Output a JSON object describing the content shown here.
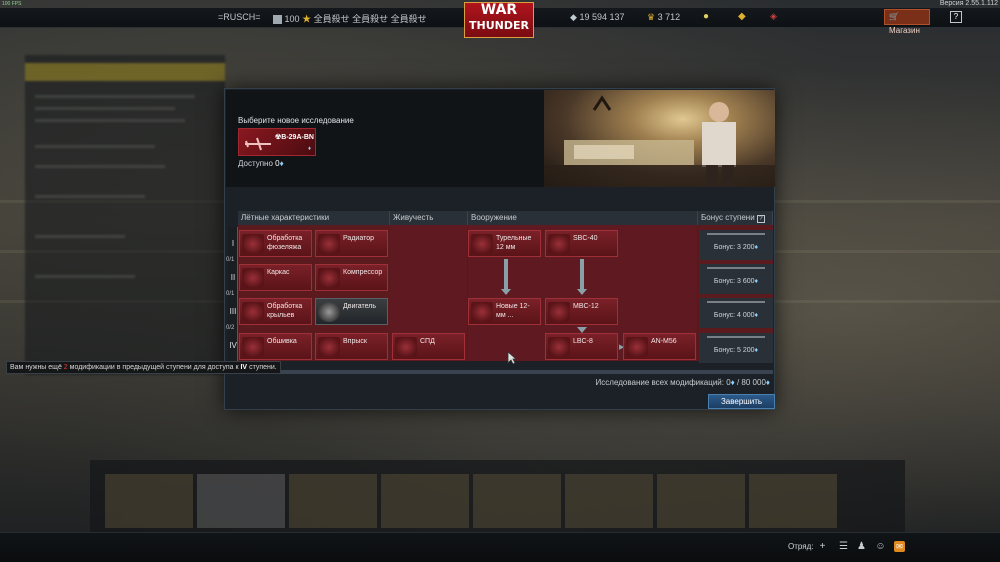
{
  "hud": {
    "fps": "100 FPS",
    "version": "Версия 2.55.1.112"
  },
  "topbar": {
    "nickname": "=RUSCH=",
    "level": "100",
    "title": "全員殺せ 全員殺せ 全員殺せ",
    "logo_line1": "WAR",
    "logo_line2": "THUNDER",
    "silver_lions": "19 594 137",
    "golden_eagles": "3 712",
    "shop_label": "Магазин",
    "help_label": "?"
  },
  "research": {
    "select_title": "Выберите новое исследование",
    "vehicle_name": "B-29A-BN",
    "available_label": "Доступно",
    "available_value": "0"
  },
  "columns": [
    {
      "label": "Лётные характеристики"
    },
    {
      "label": "Живучесть"
    },
    {
      "label": "Вооружение"
    },
    {
      "label": "Бонус ступени"
    }
  ],
  "tiers": [
    {
      "roman": "I",
      "count": "0/1"
    },
    {
      "roman": "II",
      "count": "0/1"
    },
    {
      "roman": "III",
      "count": "0/2"
    },
    {
      "roman": "IV",
      "count": ""
    }
  ],
  "modules": {
    "fuselage": "Обработка фюзеляжа",
    "radiator": "Радиатор",
    "turret": "Турельные 12 мм",
    "sbc40": "SBC-40",
    "frame": "Каркас",
    "compressor": "Компрессор",
    "wings": "Обработка крыльев",
    "engine": "Двигатель",
    "new12": "Новые 12-мм ...",
    "mbc12": "MBC-12",
    "cover": "Обшивка",
    "injection": "Впрыск",
    "spd": "СПД",
    "lbc8": "LBC-8",
    "anm56": "AN-M56"
  },
  "bonuses": [
    {
      "label": "Бонус: 3 200"
    },
    {
      "label": "Бонус: 3 600"
    },
    {
      "label": "Бонус: 4 000"
    },
    {
      "label": "Бонус: 5 200"
    }
  ],
  "footer": {
    "total_label": "Исследование всех модификаций: 0",
    "total_sep": " / 80 000",
    "finish_button": "Завершить"
  },
  "tooltip": {
    "prefix": "Вам нужны ещё",
    "count": "2",
    "middle": "модификации в предыдущей ступени для доступа к",
    "tier": "IV",
    "suffix": "ступени."
  },
  "bottombar": {
    "squad_label": "Отряд:"
  },
  "colors": {
    "accent_red": "#8a1820",
    "research_points_blue": "#8cd0ff",
    "finish_button": "#2c5a8a",
    "shop_orange": "#7a3018"
  }
}
